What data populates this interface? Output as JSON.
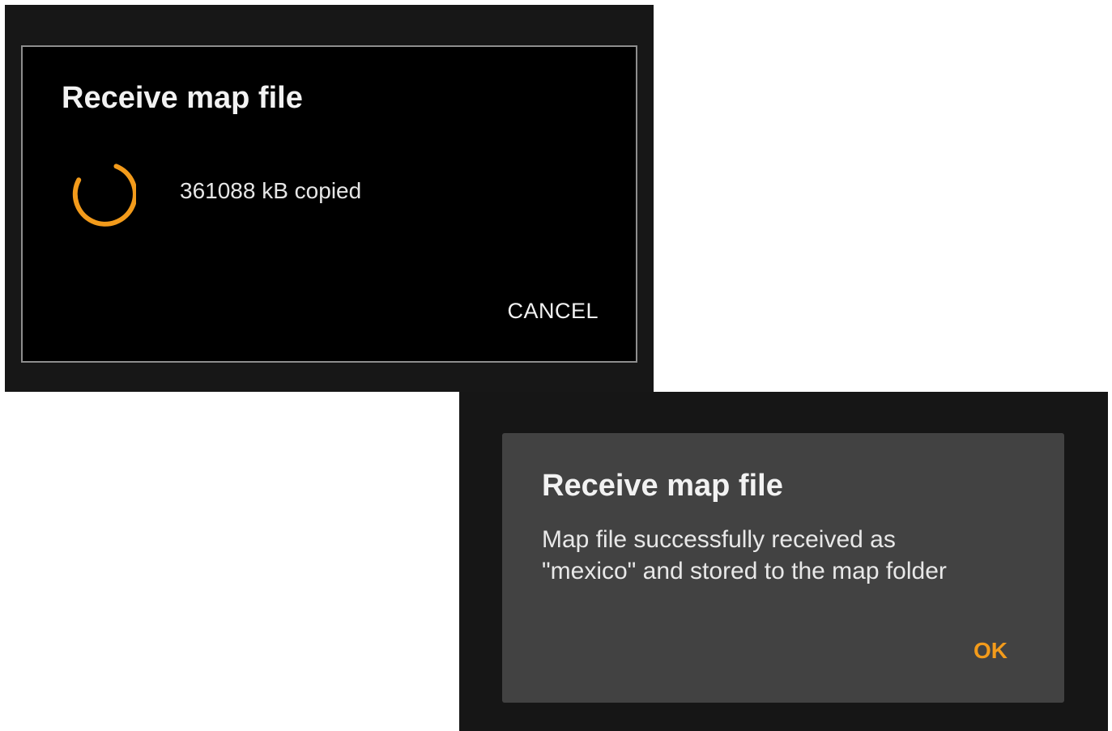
{
  "progress_dialog": {
    "title": "Receive map file",
    "status": "361088 kB copied",
    "cancel_label": "CANCEL",
    "spinner_icon": "progress-spinner-icon",
    "accent_color": "#f39b1b"
  },
  "result_dialog": {
    "title": "Receive map file",
    "message_lines": [
      "Map file successfully received as",
      "\"mexico\" and stored to the map folder"
    ],
    "ok_label": "OK",
    "accent_color": "#f39b1b"
  }
}
